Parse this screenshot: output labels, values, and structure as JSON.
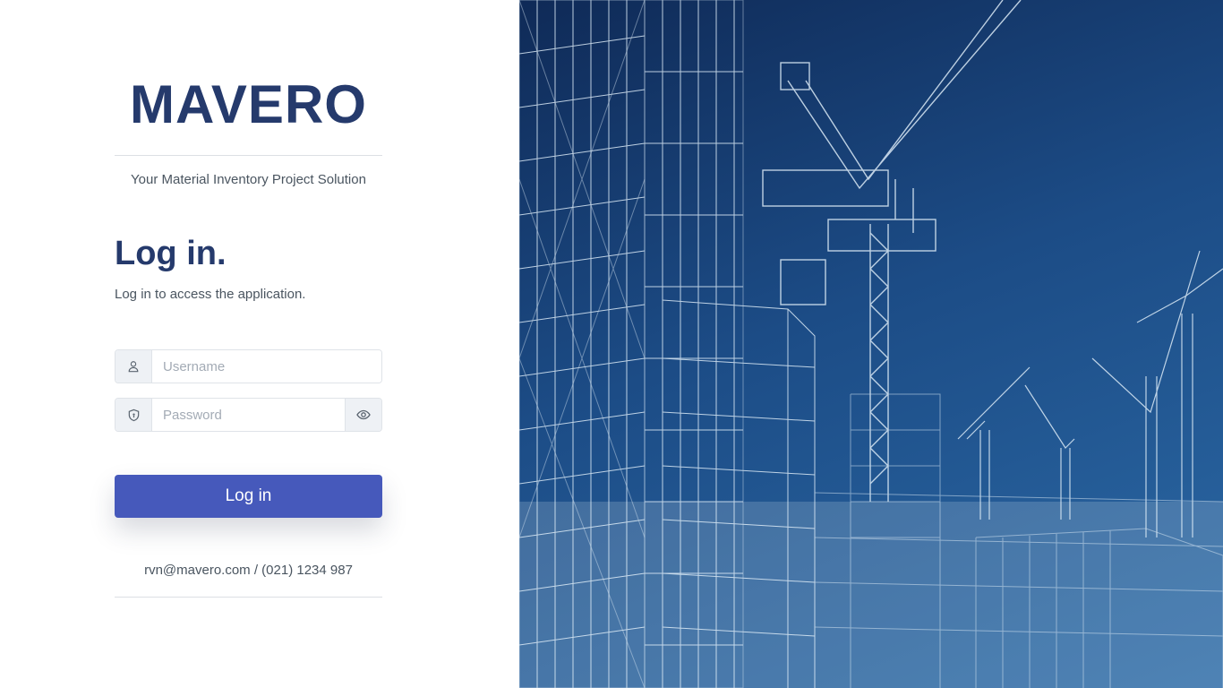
{
  "brand": {
    "name": "MAVERO",
    "tagline": "Your Material Inventory Project Solution"
  },
  "login": {
    "heading": "Log in.",
    "subheading": "Log in to access the application.",
    "username_placeholder": "Username",
    "password_placeholder": "Password",
    "button_label": "Log in"
  },
  "footer": {
    "contact": "rvn@mavero.com / (021) 1234 987"
  },
  "icons": {
    "username": "user-icon",
    "password": "shield-icon",
    "toggle": "eye-icon"
  },
  "colors": {
    "brand": "#253a6c",
    "button": "#4659bb",
    "text": "#4a5560",
    "hero_dark": "#0f2a57",
    "hero_light": "#2c6aa6"
  }
}
